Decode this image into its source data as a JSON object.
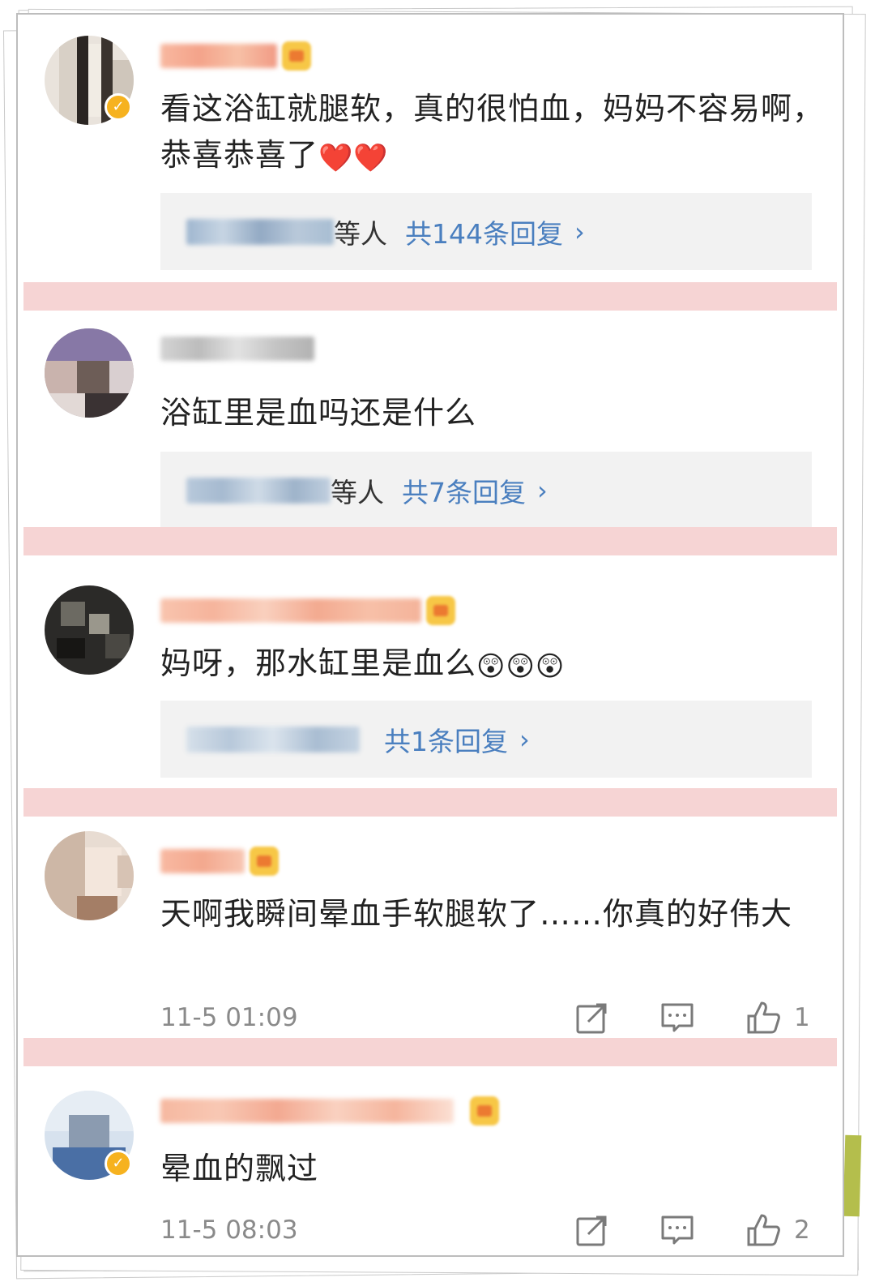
{
  "comments": [
    {
      "text": "看这浴缸就腿软，真的很怕血，妈妈不容易啊，恭喜恭喜了",
      "emoji": "❤️❤️",
      "verified": true,
      "crown": true,
      "reply_suffix": "等人",
      "reply_count_label": "共144条回复",
      "reply_chevron": "›"
    },
    {
      "text": "浴缸里是血吗还是什么",
      "emoji": "",
      "verified": false,
      "crown": false,
      "reply_suffix": "等人",
      "reply_count_label": "共7条回复",
      "reply_chevron": "›"
    },
    {
      "text": "妈呀，那水缸里是血么",
      "emoji": "😲😲😲",
      "verified": false,
      "crown": true,
      "reply_suffix": "",
      "reply_count_label": "共1条回复",
      "reply_chevron": "›"
    },
    {
      "text": "天啊我瞬间晕血手软腿软了……你真的好伟大",
      "emoji": "",
      "verified": false,
      "crown": true,
      "time": "11-5 01:09",
      "likes": "1"
    },
    {
      "text": "晕血的飘过",
      "emoji": "",
      "verified": true,
      "crown": true,
      "time": "11-5 08:03",
      "likes": "2"
    }
  ],
  "icons": {
    "verified": "verified-badge-icon",
    "crown": "vip-crown-icon",
    "share": "share-icon",
    "comment": "comment-icon",
    "like": "thumbs-up-icon"
  },
  "colors": {
    "link_blue": "#4a7fbf",
    "divider_pink": "#f6d4d4",
    "reply_bg": "#f2f2f2",
    "badge_gold": "#f6b21f",
    "meta_gray": "#8a8a8a"
  }
}
